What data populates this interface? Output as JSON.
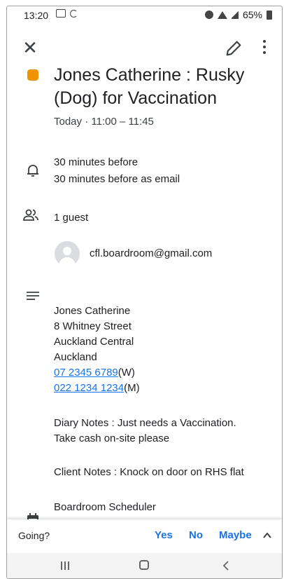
{
  "status_bar": {
    "time": "13:20",
    "battery": "65%"
  },
  "event": {
    "color": "#f09300",
    "title": "Jones Catherine : Rusky (Dog) for Vaccination",
    "when": "Today  ·  11:00 – 11:45"
  },
  "notifications": [
    "30 minutes before",
    "30 minutes before as email"
  ],
  "guests": {
    "count_label": "1 guest",
    "items": [
      "cfl.boardroom@gmail.com"
    ]
  },
  "description": {
    "lines": [
      "Jones Catherine",
      "8 Whitney Street",
      "Auckland Central",
      "Auckland"
    ],
    "phones": [
      {
        "number": "07 2345 6789",
        "suffix": "(W)"
      },
      {
        "number": "022 1234 1234",
        "suffix": "(M)"
      }
    ],
    "diary_notes_1": "Diary Notes : Just needs a Vaccination.",
    "diary_notes_2": "Take cash on-site please",
    "client_notes": "Client Notes : Knock on door on RHS flat"
  },
  "calendar": {
    "name": "Boardroom Scheduler"
  },
  "rsvp": {
    "prompt": "Going?",
    "yes": "Yes",
    "no": "No",
    "maybe": "Maybe"
  },
  "colors": {
    "link": "#1a73e8",
    "accent": "#f09300"
  }
}
